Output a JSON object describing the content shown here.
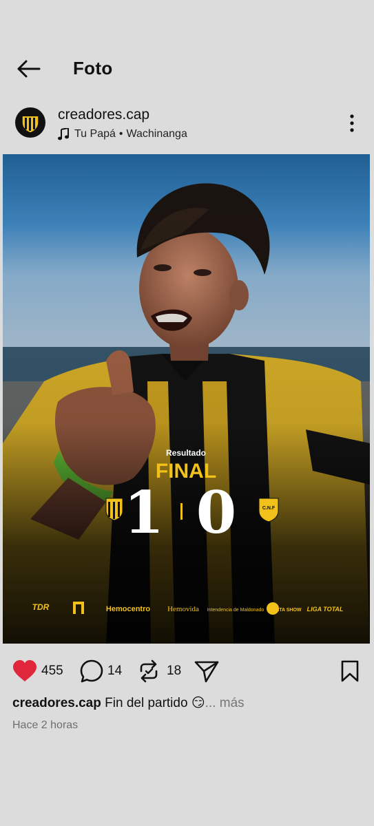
{
  "header": {
    "title": "Foto"
  },
  "post": {
    "username": "creadores.cap",
    "music": {
      "song": "Tu Papá",
      "separator": "•",
      "artist": "Wachinanga"
    }
  },
  "photo": {
    "result_label": "Resultado",
    "final_label": "FINAL",
    "home_score": "1",
    "away_score": "0",
    "sponsors": [
      "TDR",
      "Hemocentro",
      "Hemovida",
      "Intendencia de Maldonado",
      "PUNTA SHOW",
      "LIGA TOTAL"
    ]
  },
  "actions": {
    "likes": "455",
    "comments": "14",
    "reposts": "18"
  },
  "caption": {
    "username": "creadores.cap",
    "text": "Fin del partido 😏",
    "more": "... más"
  },
  "time": "Hace 2 horas",
  "colors": {
    "background": "#dcdcdc",
    "like": "#e0263a",
    "accent_yellow": "#f2c21a"
  }
}
